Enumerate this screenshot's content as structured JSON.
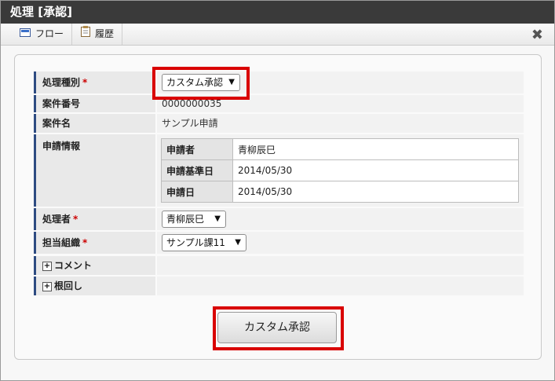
{
  "window": {
    "title": "処理 [承認]"
  },
  "toolbar": {
    "flow_label": "フロー",
    "history_label": "履歴",
    "close_glyph": "✖"
  },
  "form": {
    "process_type": {
      "label": "処理種別",
      "required_mark": "*",
      "selected": "カスタム承認",
      "arrow": "▼"
    },
    "case_number": {
      "label": "案件番号",
      "value": "0000000035"
    },
    "case_name": {
      "label": "案件名",
      "value": "サンプル申請"
    },
    "application_info": {
      "label": "申請情報",
      "rows": [
        {
          "key": "申請者",
          "value": "青柳辰巳"
        },
        {
          "key": "申請基準日",
          "value": "2014/05/30"
        },
        {
          "key": "申請日",
          "value": "2014/05/30"
        }
      ]
    },
    "processor": {
      "label": "処理者",
      "required_mark": "*",
      "selected": "青柳辰巳",
      "arrow": "▼"
    },
    "org": {
      "label": "担当組織",
      "required_mark": "*",
      "selected": "サンプル課11",
      "arrow": "▼"
    },
    "comment": {
      "label": "コメント",
      "toggle": "+"
    },
    "nemawashi": {
      "label": "根回し",
      "toggle": "+"
    }
  },
  "actions": {
    "submit_label": "カスタム承認"
  },
  "highlight_color": "#d90000"
}
